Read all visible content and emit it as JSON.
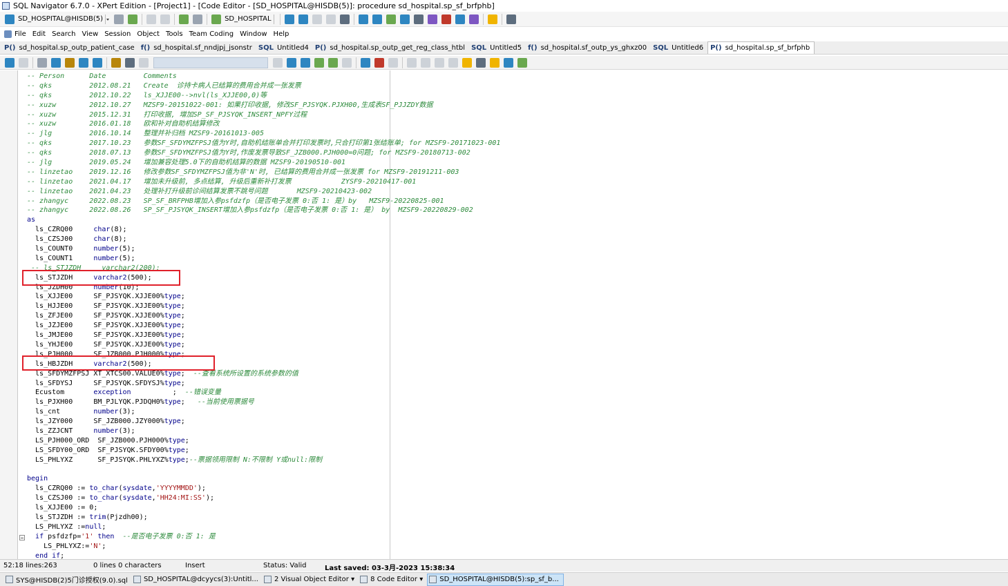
{
  "window": {
    "title": "SQL Navigator 6.7.0 - XPert Edition - [Project1] - [Code Editor - [SD_HOSPITAL@HISDB(5)]: procedure sd_hospital.sp_sf_brfphb]"
  },
  "toolbar_top": {
    "connection": "SD_HOSPITAL@HISDB(5)",
    "session": "SD_HOSPITAL"
  },
  "menu": [
    "File",
    "Edit",
    "Search",
    "View",
    "Session",
    "Object",
    "Tools",
    "Team Coding",
    "Window",
    "Help"
  ],
  "tabs": [
    {
      "icon": "P()",
      "label": "sd_hospital.sp_outp_patient_case"
    },
    {
      "icon": "f()",
      "label": "sd_hospital.sf_nndjpj_jsonstr"
    },
    {
      "icon": "SQL",
      "label": "Untitled4"
    },
    {
      "icon": "P()",
      "label": "sd_hospital.sp_outp_get_reg_class_htbl"
    },
    {
      "icon": "SQL",
      "label": "Untitled5"
    },
    {
      "icon": "f()",
      "label": "sd_hospital.sf_outp_ys_ghxz00"
    },
    {
      "icon": "SQL",
      "label": "Untitled6"
    },
    {
      "icon": "P()",
      "label": "sd_hospital.sp_sf_brfphb"
    }
  ],
  "code": [
    {
      "t": "cm",
      "s": "-- Person      Date         Comments"
    },
    {
      "t": "cm",
      "s": "-- qks         2012.08.21   Create  诊持卡病人已结算的费用合并成一张发票"
    },
    {
      "t": "cm",
      "s": "-- qks         2012.10.22   ls_XJJE00-->nvl(ls_XJJE00,0)等"
    },
    {
      "t": "cm",
      "s": "-- xuzw        2012.10.27   MZSF9-20151022-001: 如果打印收据, 修改SF_PJSYQK.PJXH00,生成表SF_PJJZDY数据"
    },
    {
      "t": "cm",
      "s": "-- xuzw        2015.12.31   打印收据, 增加SP_SF_PJSYQK_INSERT_NPFY过程"
    },
    {
      "t": "cm",
      "s": "-- xuzw        2016.01.18   欧和补对自助机结算修改"
    },
    {
      "t": "cm",
      "s": "-- jlg         2016.10.14   整理并补归档 MZSF9-20161013-005"
    },
    {
      "t": "cm",
      "s": "-- qks         2017.10.23   参数SF_SFDYMZFPSJ值为Y时,自助机结账单合并打印发票时,只合打印第1张结账单; for MZSF9-20171023-001"
    },
    {
      "t": "cm",
      "s": "-- qks         2018.07.13   参数SF_SFDYMZFPSJ值为Y时,作废发票导致SF_JZB000.PJH000=0问题; for MZSF9-20180713-002"
    },
    {
      "t": "cm",
      "s": "-- jlg         2019.05.24   增加兼容处理5.0下的自助机结算的数据 MZSF9-20190510-001"
    },
    {
      "t": "cm",
      "s": "-- linzetao    2019.12.16   修改参数SF_SFDYMZFPSJ值为非'N'时, 已结算的费用合并成一张发票 for MZSF9-20191211-003"
    },
    {
      "t": "cm",
      "s": "-- linzetao    2021.04.17   增加未升级前, 多点结算, 升级后重新补打发票            ZYSF9-20210417-001"
    },
    {
      "t": "cm",
      "s": "-- linzetao    2021.04.23   处理补打升级前诊间结算发票不跳号问题       MZSF9-20210423-002"
    },
    {
      "t": "cm",
      "s": "-- zhangyc     2022.08.23   SP_SF_BRFPHB增加入参psfdzfp（是否电子发票 0:否 1: 是）by   MZSF9-20220825-001"
    },
    {
      "t": "cm",
      "s": "-- zhangyc     2022.08.26   SP_SF_PJSYQK_INSERT增加入参psfdzfp（是否电子发票 0:否 1: 是） by  MZSF9-20220829-002"
    },
    {
      "t": "kw",
      "s": "as"
    },
    {
      "t": "pl",
      "p": [
        [
          "",
          "  ls_CZRQ00     "
        ],
        [
          "kw",
          "char"
        ],
        [
          "",
          "(8);"
        ]
      ]
    },
    {
      "t": "pl",
      "p": [
        [
          "",
          "  ls_CZSJ00     "
        ],
        [
          "kw",
          "char"
        ],
        [
          "",
          "(8);"
        ]
      ]
    },
    {
      "t": "pl",
      "p": [
        [
          "",
          "  ls_COUNT0     "
        ],
        [
          "kw",
          "number"
        ],
        [
          "",
          "(5);"
        ]
      ]
    },
    {
      "t": "pl",
      "p": [
        [
          "",
          "  ls_COUNT1     "
        ],
        [
          "kw",
          "number"
        ],
        [
          "",
          "(5);"
        ]
      ]
    },
    {
      "t": "cm",
      "s": " -- ls_STJZDH     varchar2(200);"
    },
    {
      "t": "pl",
      "p": [
        [
          "",
          "  ls_STJZDH     "
        ],
        [
          "kw",
          "varchar2"
        ],
        [
          "",
          "(500);"
        ]
      ]
    },
    {
      "t": "pl",
      "p": [
        [
          "",
          "  ls_JZDH00     "
        ],
        [
          "kw",
          "number"
        ],
        [
          "",
          "(10);"
        ]
      ]
    },
    {
      "t": "pl",
      "p": [
        [
          "",
          "  ls_XJJE00     SF_PJSYQK.XJJE00%"
        ],
        [
          "kw",
          "type"
        ],
        [
          "",
          ";"
        ]
      ]
    },
    {
      "t": "pl",
      "p": [
        [
          "",
          "  ls_HJJE00     SF_PJSYQK.XJJE00%"
        ],
        [
          "kw",
          "type"
        ],
        [
          "",
          ";"
        ]
      ]
    },
    {
      "t": "pl",
      "p": [
        [
          "",
          "  ls_ZFJE00     SF_PJSYQK.XJJE00%"
        ],
        [
          "kw",
          "type"
        ],
        [
          "",
          ";"
        ]
      ]
    },
    {
      "t": "pl",
      "p": [
        [
          "",
          "  ls_JZJE00     SF_PJSYQK.XJJE00%"
        ],
        [
          "kw",
          "type"
        ],
        [
          "",
          ";"
        ]
      ]
    },
    {
      "t": "pl",
      "p": [
        [
          "",
          "  ls_JMJE00     SF_PJSYQK.XJJE00%"
        ],
        [
          "kw",
          "type"
        ],
        [
          "",
          ";"
        ]
      ]
    },
    {
      "t": "pl",
      "p": [
        [
          "",
          "  ls_YHJE00     SF_PJSYQK.XJJE00%"
        ],
        [
          "kw",
          "type"
        ],
        [
          "",
          ";"
        ]
      ]
    },
    {
      "t": "pl",
      "p": [
        [
          "",
          "  ls_PJH000     SF_JZB000.PJH000%"
        ],
        [
          "kw",
          "type"
        ],
        [
          "",
          ";"
        ]
      ]
    },
    {
      "t": "pl",
      "p": [
        [
          "",
          "  ls_HBJZDH     "
        ],
        [
          "kw",
          "varchar2"
        ],
        [
          "",
          "(500);"
        ]
      ]
    },
    {
      "t": "pl",
      "p": [
        [
          "",
          "  ls_SFDYMZFPSJ XT_XTCS00.VALUE0%"
        ],
        [
          "kw",
          "type"
        ],
        [
          "",
          ";  "
        ],
        [
          "cm",
          "--查看系统所设置的系统参数的值"
        ]
      ]
    },
    {
      "t": "pl",
      "p": [
        [
          "",
          "  ls_SFDYSJ     SF_PJSYQK.SFDYSJ%"
        ],
        [
          "kw",
          "type"
        ],
        [
          "",
          ";"
        ]
      ]
    },
    {
      "t": "pl",
      "p": [
        [
          "",
          "  Ecustom       "
        ],
        [
          "kw",
          "exception"
        ],
        [
          "",
          "          ;  "
        ],
        [
          "cm",
          "--错误变量"
        ]
      ]
    },
    {
      "t": "pl",
      "p": [
        [
          "",
          "  ls_PJXH00     BM_PJLYQK.PJDQH0%"
        ],
        [
          "kw",
          "type"
        ],
        [
          "",
          ";   "
        ],
        [
          "cm",
          "--当前使用票据号"
        ]
      ]
    },
    {
      "t": "pl",
      "p": [
        [
          "",
          "  ls_cnt        "
        ],
        [
          "kw",
          "number"
        ],
        [
          "",
          "(3);"
        ]
      ]
    },
    {
      "t": "pl",
      "p": [
        [
          "",
          "  ls_JZY000     SF_JZB000.JZY000%"
        ],
        [
          "kw",
          "type"
        ],
        [
          "",
          ";"
        ]
      ]
    },
    {
      "t": "pl",
      "p": [
        [
          "",
          "  ls_ZZJCNT     "
        ],
        [
          "kw",
          "number"
        ],
        [
          "",
          "(3);"
        ]
      ]
    },
    {
      "t": "pl",
      "p": [
        [
          "",
          "  LS_PJH000_ORD  SF_JZB000.PJH000%"
        ],
        [
          "kw",
          "type"
        ],
        [
          "",
          ";"
        ]
      ]
    },
    {
      "t": "pl",
      "p": [
        [
          "",
          "  LS_SFDY00_ORD  SF_PJSYQK.SFDY00%"
        ],
        [
          "kw",
          "type"
        ],
        [
          "",
          ";"
        ]
      ]
    },
    {
      "t": "pl",
      "p": [
        [
          "",
          "  LS_PHLYXZ      SF_PJSYQK.PHLYXZ%"
        ],
        [
          "kw",
          "type"
        ],
        [
          "",
          ";"
        ],
        [
          "cm",
          "--票据领用限制 N:不限制 Y或null:限制"
        ]
      ]
    },
    {
      "t": "pl",
      "p": [
        [
          "",
          ""
        ]
      ]
    },
    {
      "t": "kw",
      "s": "begin"
    },
    {
      "t": "pl",
      "p": [
        [
          "",
          "  ls_CZRQ00 := "
        ],
        [
          "kw",
          "to_char"
        ],
        [
          "",
          "("
        ],
        [
          "kw",
          "sysdate"
        ],
        [
          "",
          ","
        ],
        [
          "st",
          "'YYYYMMDD'"
        ],
        [
          "",
          ");"
        ]
      ]
    },
    {
      "t": "pl",
      "p": [
        [
          "",
          "  ls_CZSJ00 := "
        ],
        [
          "kw",
          "to_char"
        ],
        [
          "",
          "("
        ],
        [
          "kw",
          "sysdate"
        ],
        [
          "",
          ","
        ],
        [
          "st",
          "'HH24:MI:SS'"
        ],
        [
          "",
          ");"
        ]
      ]
    },
    {
      "t": "pl",
      "p": [
        [
          "",
          "  ls_XJJE00 := 0;"
        ]
      ]
    },
    {
      "t": "pl",
      "p": [
        [
          "",
          "  ls_STJZDH := "
        ],
        [
          "kw",
          "trim"
        ],
        [
          "",
          "(Pjzdh00);"
        ]
      ]
    },
    {
      "t": "pl",
      "p": [
        [
          "",
          "  LS_PHLYXZ :="
        ],
        [
          "kw",
          "null"
        ],
        [
          "",
          ";"
        ]
      ]
    },
    {
      "t": "pl",
      "p": [
        [
          "",
          "  "
        ],
        [
          "kw",
          "if"
        ],
        [
          "",
          " psfdzfp="
        ],
        [
          "st",
          "'1'"
        ],
        [
          "",
          " "
        ],
        [
          "kw",
          "then"
        ],
        [
          "",
          "  "
        ],
        [
          "cm",
          "--是否电子发票 0:否 1: 是"
        ]
      ]
    },
    {
      "t": "pl",
      "p": [
        [
          "",
          "    LS_PHLYXZ:="
        ],
        [
          "st",
          "'N'"
        ],
        [
          "",
          ";"
        ]
      ]
    },
    {
      "t": "pl",
      "p": [
        [
          "",
          "  "
        ],
        [
          "kw",
          "end if"
        ],
        [
          "",
          ";"
        ]
      ]
    }
  ],
  "status": {
    "position": "52:18 lines:263",
    "selection": "0 lines 0 characters",
    "mode": "Insert",
    "state": "Status: Valid",
    "last_saved": "Last saved: 03-3月-2023 15:38:34"
  },
  "taskbar": [
    {
      "label": "SYS@HISDB(2)5门诊授权(9.0).sql",
      "active": false
    },
    {
      "label": "SD_HOSPITAL@dcyycs(3):Untitl...",
      "active": false
    },
    {
      "label": "2 Visual Object Editor ▾",
      "active": false
    },
    {
      "label": "8 Code Editor ▾",
      "active": false
    },
    {
      "label": "SD_HOSPITAL@HISDB(5):sp_sf_b...",
      "active": true
    }
  ]
}
